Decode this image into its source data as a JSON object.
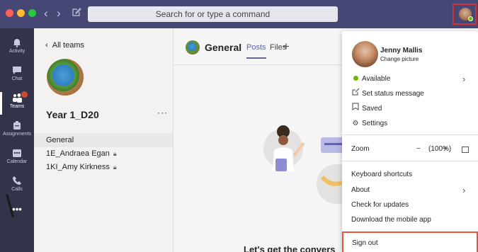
{
  "window": {
    "search_placeholder": "Search for or type a command"
  },
  "rail": {
    "items": [
      {
        "label": "Activity",
        "icon": "bell-icon"
      },
      {
        "label": "Chat",
        "icon": "chat-icon"
      },
      {
        "label": "Teams",
        "icon": "teams-icon",
        "active": true
      },
      {
        "label": "Assignments",
        "icon": "assignments-icon"
      },
      {
        "label": "Calendar",
        "icon": "calendar-icon"
      },
      {
        "label": "Calls",
        "icon": "phone-icon"
      },
      {
        "label": "•••",
        "icon": "more-icon"
      }
    ]
  },
  "team_panel": {
    "back_label": "All teams",
    "team_name": "Year 1_D20",
    "more": "···",
    "channels": [
      {
        "label": "General",
        "selected": true,
        "locked": false
      },
      {
        "label": "1E_Andraea Egan",
        "selected": false,
        "locked": true
      },
      {
        "label": "1KI_Amy Kirkness",
        "selected": false,
        "locked": true
      }
    ]
  },
  "main": {
    "channel_title": "General",
    "tabs": [
      {
        "label": "Posts",
        "active": true
      },
      {
        "label": "Files",
        "active": false
      }
    ],
    "add_tab": "+",
    "empty_title": "Let's get the convers"
  },
  "profile_menu": {
    "name": "Jenny Mallis",
    "change_picture": "Change picture",
    "status": "Available",
    "set_status": "Set status message",
    "saved": "Saved",
    "settings": "Settings",
    "zoom_label": "Zoom",
    "zoom_minus": "−",
    "zoom_value": "(100%)",
    "zoom_plus": "+",
    "keyboard_shortcuts": "Keyboard shortcuts",
    "about": "About",
    "check_updates": "Check for updates",
    "download_app": "Download the mobile app",
    "sign_out": "Sign out"
  },
  "overlay": {
    "left_char": "\\",
    "right_char": "V"
  },
  "colors": {
    "titlebar": "#464775",
    "rail": "#33344a",
    "accent": "#6264a7",
    "status_green": "#6bb700",
    "highlight_red": "#d13438"
  }
}
